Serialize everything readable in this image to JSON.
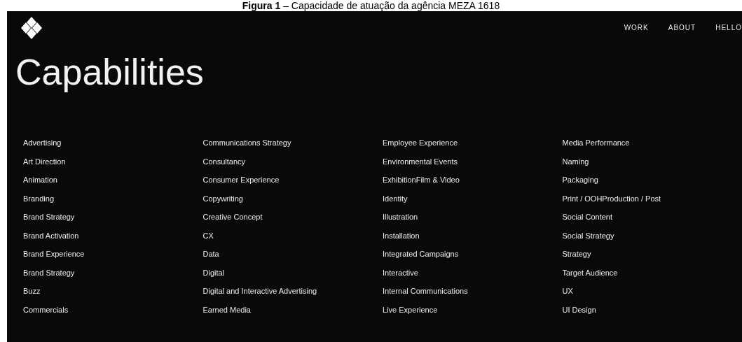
{
  "caption": "**Figura 1** – Capacidade de atuação da agência MEZA 1618",
  "nav": [
    "WORK",
    "ABOUT",
    "HELLO"
  ],
  "heading": "Capabilities",
  "columns": [
    [
      "Advertising",
      "Art Direction",
      "Animation",
      "Branding",
      "Brand Strategy",
      "Brand Activation",
      "Brand Experience",
      "Brand Strategy",
      "Buzz",
      "Commercials"
    ],
    [
      "Communications Strategy",
      "Consultancy",
      "Consumer Experience",
      "Copywriting",
      "Creative Concept",
      "CX",
      "Data",
      "Digital",
      "Digital and Interactive Advertising",
      "Earned Media"
    ],
    [
      "Employee Experience",
      "Environmental Events",
      "ExhibitionFilm & Video",
      "Identity",
      "Illustration",
      "Installation",
      "Integrated Campaigns",
      "Interactive",
      "Internal Communications",
      "Live Experience"
    ],
    [
      "Media Performance",
      "Naming",
      "Packaging",
      "Print / OOHProduction / Post",
      "Social Content",
      "Social Strategy",
      "Strategy",
      "Target Audience",
      "UX",
      "UI Design"
    ]
  ]
}
